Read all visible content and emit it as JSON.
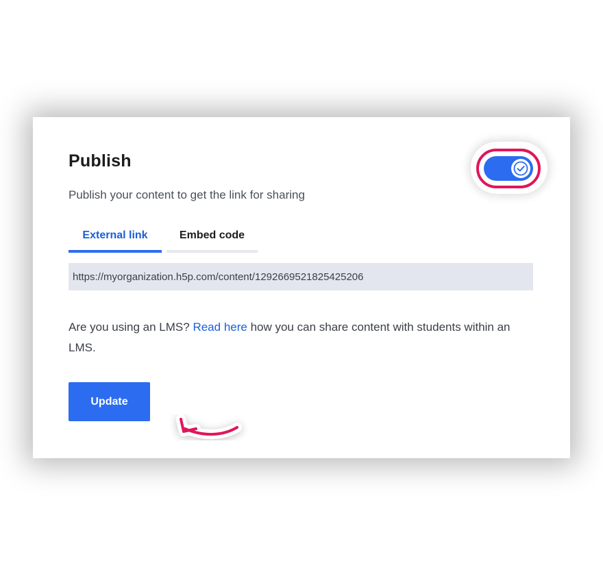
{
  "publish": {
    "title": "Publish",
    "subtitle": "Publish your content to get the link for sharing",
    "toggle_state": "on"
  },
  "tabs": [
    {
      "label": "External link",
      "active": true
    },
    {
      "label": "Embed code",
      "active": false
    }
  ],
  "link": {
    "value": "https://myorganization.h5p.com/content/1292669521825425206"
  },
  "lms": {
    "prefix": "Are you using an LMS? ",
    "link_label": "Read here",
    "suffix": " how you can share content with students within an LMS."
  },
  "actions": {
    "update_label": "Update"
  },
  "colors": {
    "accent": "#2c6cf0",
    "highlight": "#e0155a",
    "field_bg": "#e3e6ee"
  },
  "icons": {
    "toggle": "check-icon",
    "annotation": "curved-arrow-icon"
  }
}
